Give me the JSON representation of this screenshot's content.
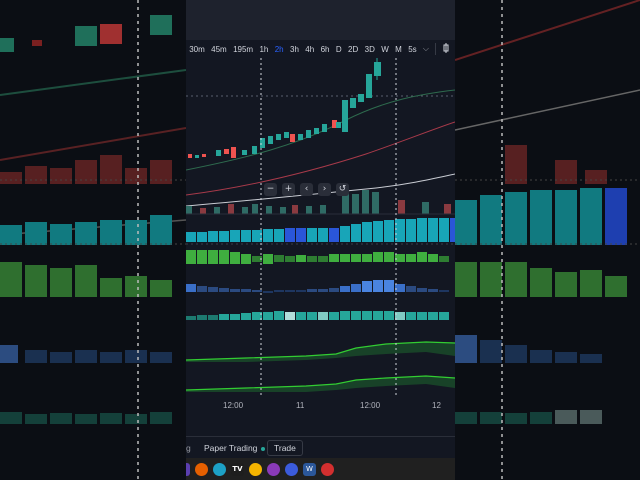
{
  "toolbar": {
    "timeframes": [
      {
        "label": "30m",
        "active": false
      },
      {
        "label": "45m",
        "active": false
      },
      {
        "label": "195m",
        "active": false
      },
      {
        "label": "1h",
        "active": false
      },
      {
        "label": "2h",
        "active": true
      },
      {
        "label": "3h",
        "active": false
      },
      {
        "label": "4h",
        "active": false
      },
      {
        "label": "6h",
        "active": false
      },
      {
        "label": "D",
        "active": false
      },
      {
        "label": "2D",
        "active": false
      },
      {
        "label": "3D",
        "active": false
      },
      {
        "label": "W",
        "active": false
      },
      {
        "label": "M",
        "active": false
      },
      {
        "label": "5s",
        "active": false
      }
    ],
    "more_icon": "chevron-down-icon",
    "chart_type_icon": "candles-icon"
  },
  "chart_nav": {
    "zoom_out": "−",
    "zoom_in": "+",
    "scroll_left": "‹",
    "scroll_right": "›",
    "reset": "↺"
  },
  "time_axis": {
    "ticks": [
      "12:00",
      "11",
      "12:00",
      "12"
    ]
  },
  "bottom_bar": {
    "partial_tab": "g",
    "paper_trading": "Paper Trading",
    "trade": "Trade"
  },
  "taskbar": {
    "icons": [
      "app-icon",
      "firefox-icon",
      "edge-icon",
      "tradingview-icon",
      "chrome-icon",
      "media-icon",
      "browser-icon",
      "word-icon",
      "pdf-icon"
    ]
  },
  "colors": {
    "bull": "#26a69a",
    "bear": "#ef5350",
    "background": "#131722",
    "accent": "#2962ff"
  }
}
